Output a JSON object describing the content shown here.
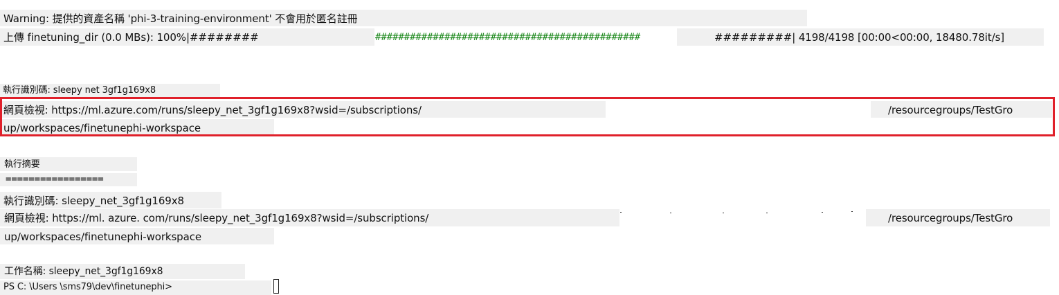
{
  "terminal": {
    "warning_line": "Warning: 提供的資產名稱 'phi-3-training-environment' 不會用於匿名註冊",
    "upload": {
      "prefix": "上傳 finetuning_dir (0.0 MBs): 100%|########",
      "bar_middle": "##############################################",
      "bar_end": "#########| 4198/4198 [00:00<00:00, 18480.78it/s]",
      "progress_percent": 100
    },
    "run_id_line_1": "執行識別碼: sleepy net 3gf1g169x8",
    "web_view_1": {
      "part1": "網頁檢視: https://ml.azure.com/runs/sleepy_net_3gf1g169x8?wsid=/subscriptions/",
      "part2": "/resourcegroups/TestGro",
      "part3": "up/workspaces/finetunephi-workspace"
    },
    "summary_title": "執行摘要",
    "summary_divider": "=================",
    "run_id_line_2": "執行識別碼: sleepy_net_3gf1g169x8",
    "web_view_2": {
      "part1": "網頁檢視: https://ml. azure. com/runs/sleepy_net_3gf1g169x8?wsid=/subscriptions/",
      "part2": "/resourcegroups/TestGro",
      "part3": "up/workspaces/finetunephi-workspace"
    },
    "job_name_line": "工作名稱: sleepy_net_3gf1g169x8",
    "prompt": "PS C: \\Users \\sms79\\dev\\finetunephi>"
  },
  "colors": {
    "highlight_border": "#e0202a",
    "progress_bar": "#1f8a1f",
    "line_background": "#f0f0f0"
  }
}
